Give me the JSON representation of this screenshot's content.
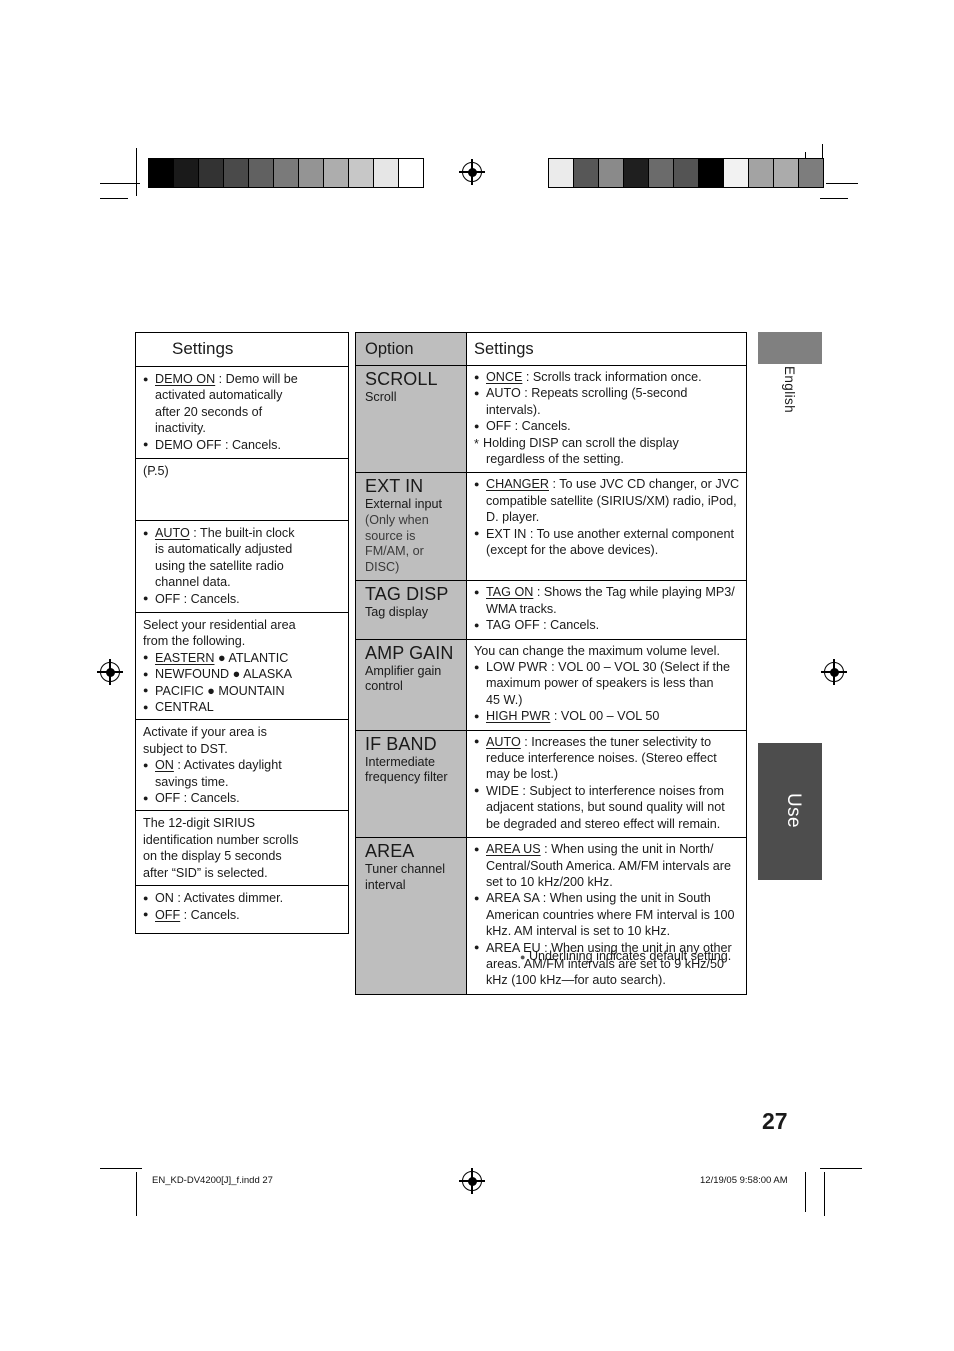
{
  "document": {
    "page_number": "27",
    "language_tab": "English",
    "section_tab": "Use",
    "footer_left": "EN_KD-DV4200[J]_f.indd   27",
    "footer_right": "12/19/05   9:58:00 AM",
    "footnote": "Underlining indicates default setting.",
    "colors": {
      "option_column_bg": "#bebebe",
      "language_tab_bg": "#808080",
      "section_tab_bg": "#4d4d4d",
      "border": "#000000",
      "text": "#1a1a1a"
    }
  },
  "left_table": {
    "header": "Settings",
    "rows": [
      {
        "lines": [
          {
            "style": "bullet",
            "text": "DEMO ON : Demo will be",
            "underline": "DEMO ON"
          },
          {
            "style": "indent",
            "text": "activated automatically"
          },
          {
            "style": "indent",
            "text": "after 20 seconds of"
          },
          {
            "style": "indent",
            "text": "inactivity."
          },
          {
            "style": "bullet",
            "text": "DEMO OFF : Cancels."
          }
        ]
      },
      {
        "lines": [
          {
            "style": "plain",
            "text": "(P.5)"
          }
        ]
      },
      {
        "lines": [
          {
            "style": "bullet",
            "text": "AUTO : The built-in clock",
            "underline": "AUTO"
          },
          {
            "style": "indent",
            "text": "is automatically adjusted"
          },
          {
            "style": "indent",
            "text": "using the satellite radio"
          },
          {
            "style": "indent",
            "text": "channel data."
          },
          {
            "style": "bullet",
            "text": "OFF : Cancels."
          }
        ]
      },
      {
        "lines": [
          {
            "style": "plain",
            "text": "Select your residential area"
          },
          {
            "style": "plain",
            "text": "from the following."
          },
          {
            "style": "bullet",
            "text": "EASTERN ● ATLANTIC",
            "underline": "EASTERN"
          },
          {
            "style": "bullet",
            "text": "NEWFOUND ● ALASKA"
          },
          {
            "style": "bullet",
            "text": "PACIFIC ● MOUNTAIN"
          },
          {
            "style": "bullet",
            "text": "CENTRAL"
          }
        ]
      },
      {
        "lines": [
          {
            "style": "plain",
            "text": "Activate if your area is"
          },
          {
            "style": "plain",
            "text": "subject to DST."
          },
          {
            "style": "bullet",
            "text": "ON : Activates daylight",
            "underline": "ON"
          },
          {
            "style": "indent",
            "text": "savings time."
          },
          {
            "style": "bullet",
            "text": "OFF : Cancels."
          }
        ]
      },
      {
        "lines": [
          {
            "style": "plain",
            "text": "The 12-digit SIRIUS"
          },
          {
            "style": "plain",
            "text": "identification number scrolls"
          },
          {
            "style": "plain",
            "text": "on the display 5 seconds"
          },
          {
            "style": "plain",
            "text": "after “SID” is selected."
          }
        ]
      },
      {
        "lines": [
          {
            "style": "bullet",
            "text": "ON : Activates dimmer."
          },
          {
            "style": "bullet",
            "text": "OFF : Cancels.",
            "underline": "OFF"
          }
        ]
      }
    ]
  },
  "right_table": {
    "header_option": "Option",
    "header_settings": "Settings",
    "rows": [
      {
        "code": "SCROLL",
        "desc": "Scroll",
        "note": "",
        "lines": [
          {
            "style": "bullet",
            "text": "ONCE : Scrolls track information once.",
            "underline": "ONCE"
          },
          {
            "style": "bullet",
            "text": "AUTO : Repeats scrolling (5-second"
          },
          {
            "style": "indent",
            "text": "intervals)."
          },
          {
            "style": "bullet",
            "text": "OFF : Cancels."
          },
          {
            "style": "star",
            "text": "Holding DISP can scroll the display"
          },
          {
            "style": "indent",
            "text": "regardless of the setting."
          }
        ]
      },
      {
        "code": "EXT IN",
        "desc": "External input",
        "note": "(Only when source is FM/AM, or DISC)",
        "lines": [
          {
            "style": "bullet",
            "text": "CHANGER : To use JVC CD changer, or JVC",
            "underline": "CHANGER"
          },
          {
            "style": "indent",
            "text": "compatible satellite (SIRIUS/XM) radio, iPod,"
          },
          {
            "style": "indent",
            "text": "D. player."
          },
          {
            "style": "bullet",
            "text": "EXT IN : To use another external component"
          },
          {
            "style": "indent",
            "text": "(except for the above devices)."
          }
        ]
      },
      {
        "code": "TAG DISP",
        "desc": "Tag display",
        "note": "",
        "lines": [
          {
            "style": "bullet",
            "text": "TAG ON : Shows the Tag while playing MP3/",
            "underline": "TAG ON"
          },
          {
            "style": "indent",
            "text": "WMA tracks."
          },
          {
            "style": "bullet",
            "text": "TAG OFF : Cancels."
          }
        ]
      },
      {
        "code": "AMP GAIN",
        "desc": "Amplifier gain control",
        "note": "",
        "lines": [
          {
            "style": "plain",
            "text": "You can change the maximum volume level."
          },
          {
            "style": "bullet",
            "text": "LOW PWR : VOL 00 – VOL 30 (Select if the"
          },
          {
            "style": "indent",
            "text": "maximum power of speakers is less than"
          },
          {
            "style": "indent",
            "text": "45 W.)"
          },
          {
            "style": "bullet",
            "text": "HIGH PWR : VOL 00 – VOL 50",
            "underline": "HIGH PWR"
          }
        ]
      },
      {
        "code": "IF BAND",
        "desc": "Intermediate frequency filter",
        "note": "",
        "lines": [
          {
            "style": "bullet",
            "text": "AUTO : Increases the tuner selectivity to",
            "underline": "AUTO"
          },
          {
            "style": "indent",
            "text": "reduce interference noises. (Stereo effect"
          },
          {
            "style": "indent",
            "text": "may be lost.)"
          },
          {
            "style": "bullet",
            "text": "WIDE : Subject to interference noises from"
          },
          {
            "style": "indent",
            "text": "adjacent stations, but sound quality will not"
          },
          {
            "style": "indent",
            "text": "be degraded and stereo effect will remain."
          }
        ]
      },
      {
        "code": "AREA",
        "desc": "Tuner channel interval",
        "note": "",
        "lines": [
          {
            "style": "bullet",
            "text": "AREA US : When using the unit in North/",
            "underline": "AREA US"
          },
          {
            "style": "indent",
            "text": "Central/South America. AM/FM intervals are"
          },
          {
            "style": "indent",
            "text": "set to 10 kHz/200 kHz."
          },
          {
            "style": "bullet",
            "text": "AREA SA : When using the unit in South"
          },
          {
            "style": "indent",
            "text": "American countries where FM interval is 100"
          },
          {
            "style": "indent",
            "text": "kHz. AM interval is set to 10 kHz."
          },
          {
            "style": "bullet",
            "text": "AREA EU : When using the unit in any other"
          },
          {
            "style": "indent",
            "text": "areas. AM/FM intervals are set to 9 kHz/50"
          },
          {
            "style": "indent",
            "text": "kHz (100 kHz—for auto search)."
          }
        ]
      }
    ]
  },
  "calibration": {
    "left_strip": [
      "#000000",
      "#1a1a1a",
      "#333333",
      "#4a4a4a",
      "#616161",
      "#7a7a7a",
      "#949494",
      "#adadad",
      "#c7c7c7",
      "#e6e6e6",
      "#ffffff"
    ],
    "right_strip": [
      "#ebebeb",
      "#575757",
      "#8a8a8a",
      "#1f1f1f",
      "#6b6b6b",
      "#545454",
      "#000000",
      "#f2f2f2",
      "#a3a3a3",
      "#ababab",
      "#7d7d7d"
    ]
  }
}
